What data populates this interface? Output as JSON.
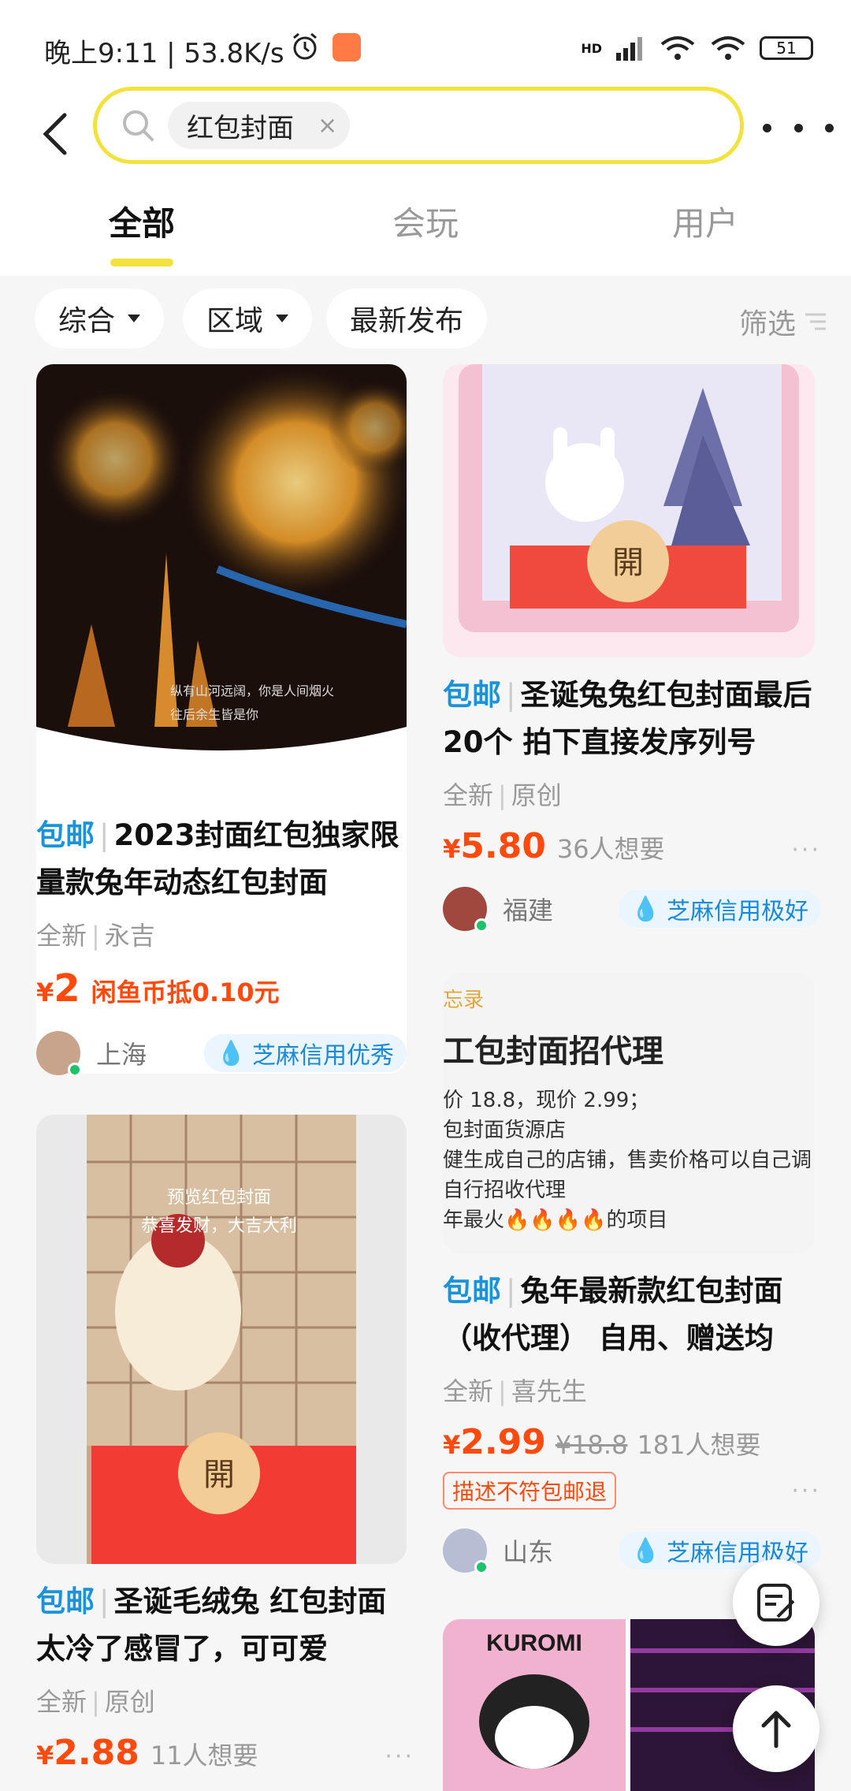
{
  "status": {
    "time_text": "晚上9:11 | 53.8K/s",
    "signal_label": "HD",
    "battery": "51"
  },
  "search": {
    "query": "红包封面",
    "clear_symbol": "×"
  },
  "tabs": [
    {
      "label": "全部",
      "active": true
    },
    {
      "label": "会玩",
      "active": false
    },
    {
      "label": "用户",
      "active": false
    }
  ],
  "filters": {
    "items": [
      "综合",
      "区域",
      "最新发布"
    ],
    "right_label": "筛选"
  },
  "cards": {
    "c1": {
      "badge": "包邮",
      "title": "2023封面红包独家限量款兔年动态红包封面",
      "condition": "全新",
      "sub": "永吉",
      "currency": "¥",
      "price": "2",
      "price_note": "闲鱼币抵0.10元",
      "location": "上海",
      "credit": "芝麻信用优秀",
      "img_caption1": "纵有山河远阔，你是人间烟火",
      "img_caption2": "往后余生皆是你"
    },
    "c2": {
      "badge": "包邮",
      "title": "圣诞兔兔红包封面最后20个 拍下直接发序列号",
      "condition": "全新",
      "sub": "原创",
      "currency": "¥",
      "price": "5.80",
      "wants": "36人想要",
      "location": "福建",
      "credit": "芝麻信用极好",
      "img_open": "開"
    },
    "c3": {
      "badge": "包邮",
      "title": "兔年最新款红包封面（收代理） 自用、赠送均",
      "condition": "全新",
      "sub": "喜先生",
      "currency": "¥",
      "price": "2.99",
      "old_price": "¥18.8",
      "wants": "181人想要",
      "tag": "描述不符包邮退",
      "location": "山东",
      "credit": "芝麻信用极好",
      "img_lines": [
        "忘录",
        "工包封面招代理",
        "价 18.8，现价 2.99；",
        "包封面货源店",
        "健生成自己的店铺，售卖价格可以自己调",
        "自行招收代理",
        "年最火🔥🔥🔥🔥的项目"
      ]
    },
    "c4": {
      "badge": "包邮",
      "title": "圣诞毛绒兔 红包封面 太冷了感冒了，可可爱",
      "condition": "全新",
      "sub": "原创",
      "currency": "¥",
      "price": "2.88",
      "wants": "11人想要",
      "img_preview": "预览红包封面",
      "img_greeting": "恭喜发财，大吉大利",
      "img_open": "開"
    },
    "c5": {
      "img_text": "KUROMI"
    }
  },
  "more_symbol": "···"
}
